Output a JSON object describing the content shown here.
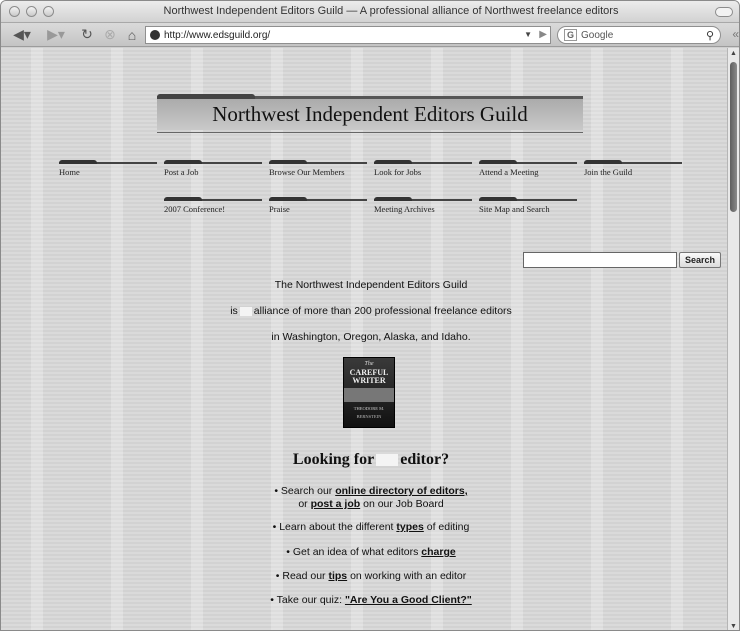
{
  "window": {
    "title": "Northwest Independent Editors Guild — A professional alliance of Northwest freelance editors"
  },
  "toolbar": {
    "url": "http://www.edsguild.org/",
    "search_placeholder": "Google",
    "icons": [
      "back-icon",
      "forward-icon",
      "reload-icon",
      "stop-icon",
      "home-icon"
    ]
  },
  "banner": {
    "title": "Northwest Independent Editors Guild"
  },
  "nav": {
    "row1": [
      "Home",
      "Post a Job",
      "Browse Our Members",
      "Look for Jobs",
      "Attend a Meeting",
      "Join the Guild"
    ],
    "row2": [
      "2007 Conference!",
      "Praise",
      "Meeting Archives",
      "Site Map and Search"
    ]
  },
  "search": {
    "button": "Search",
    "value": ""
  },
  "intro": {
    "line1": "The Northwest Independent Editors Guild",
    "line2_pre": "is",
    "line2_post": "alliance of more than 200 professional freelance editors",
    "line3": "in Washington, Oregon, Alaska, and Idaho."
  },
  "book": {
    "line1": "The",
    "line2": "CAREFUL WRITER",
    "line3": "THEODORE M.",
    "line4": "BERNSTEIN"
  },
  "looking": {
    "pre": "Looking for",
    "post": "editor?"
  },
  "bullets": {
    "b1_pre": "Search our",
    "b1_link": "online directory of editors,",
    "b1b_pre": "or",
    "b1b_link": "post a job",
    "b1b_post": "on our Job Board",
    "b2_pre": "Learn about the different",
    "b2_link": "types",
    "b2_post": "of editing",
    "b3_pre": "Get an idea of what editors",
    "b3_link": "charge",
    "b4_pre": "Read our",
    "b4_link": "tips",
    "b4_post": "on working with an editor",
    "b5_pre": "Take our quiz:",
    "b5_link": "\"Are You a Good Client?\""
  }
}
